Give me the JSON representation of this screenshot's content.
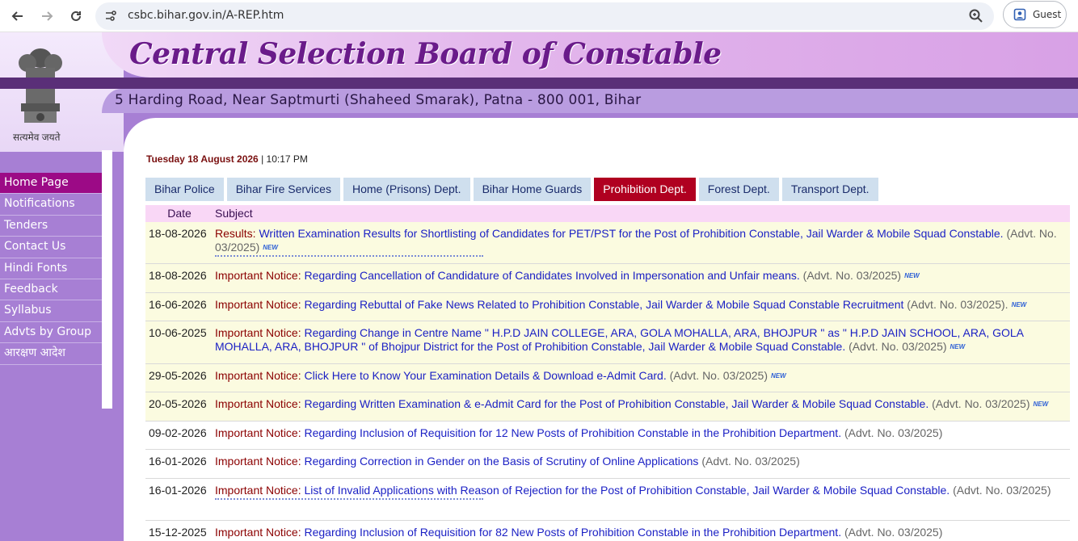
{
  "browser": {
    "url": "csbc.bihar.gov.in/A-REP.htm",
    "profile_label": "Guest"
  },
  "header": {
    "title": "Central Selection Board of Constable",
    "address": "5 Harding Road, Near Saptmurti (Shaheed Smarak), Patna - 800 001, Bihar",
    "motto": "सत्यमेव जयते"
  },
  "sidebar": {
    "items": [
      {
        "label": "Home Page"
      },
      {
        "label": "Notifications"
      },
      {
        "label": "Tenders"
      },
      {
        "label": "Contact Us"
      },
      {
        "label": "Hindi Fonts"
      },
      {
        "label": "Feedback"
      },
      {
        "label": "Syllabus"
      },
      {
        "label": "Advts by Group"
      },
      {
        "label": "आरक्षण आदेश"
      }
    ]
  },
  "datetime": {
    "date": "Tuesday 18 August 2026",
    "sep": "|",
    "time": "10:17 PM"
  },
  "tabs": [
    {
      "label": "Bihar Police"
    },
    {
      "label": "Bihar Fire Services"
    },
    {
      "label": "Home (Prisons) Dept."
    },
    {
      "label": "Bihar Home Guards"
    },
    {
      "label": "Prohibition Dept."
    },
    {
      "label": "Forest Dept."
    },
    {
      "label": "Transport Dept."
    }
  ],
  "table": {
    "headers": {
      "date": "Date",
      "subject": "Subject"
    },
    "rows": [
      {
        "date": "18-08-2026",
        "prefix": "Results:",
        "link": "Written Examination Results for Shortlisting of Candidates for PET/PST for the Post of Prohibition Constable, Jail Warder & Mobile Squad Constable.",
        "advt": "(Advt. No. 03/2025)",
        "new_badge": "NEW"
      },
      {
        "date": "18-08-2026",
        "prefix": "Important Notice:",
        "link": "Regarding Cancellation of Candidature of Candidates Involved in Impersonation and Unfair means.",
        "advt": "(Advt. No. 03/2025)",
        "new_badge": "NEW"
      },
      {
        "date": "16-06-2026",
        "prefix": "Important Notice:",
        "link": "Regarding Rebuttal of Fake News Related to Prohibition Constable, Jail Warder & Mobile Squad Constable Recruitment",
        "advt": "(Advt. No. 03/2025).",
        "new_badge": "NEW"
      },
      {
        "date": "10-06-2025",
        "prefix": "Important Notice:",
        "link": "Regarding Change in Centre Name \" H.P.D JAIN COLLEGE, ARA, GOLA MOHALLA, ARA, BHOJPUR \" as \" H.P.D JAIN SCHOOL, ARA, GOLA MOHALLA, ARA, BHOJPUR \" of Bhojpur District for the Post of Prohibition Constable, Jail Warder & Mobile Squad Constable.",
        "advt": "(Advt. No. 03/2025)",
        "new_badge": "NEW"
      },
      {
        "date": "29-05-2026",
        "prefix": "Important Notice:",
        "link": "Click Here to Know Your Examination Details & Download e-Admit Card.",
        "advt": "(Advt. No. 03/2025)",
        "new_badge": "NEW"
      },
      {
        "date": "20-05-2026",
        "prefix": "Important Notice:",
        "link": "Regarding Written Examination & e-Admit Card for the Post of Prohibition Constable, Jail Warder & Mobile Squad Constable.",
        "advt": "(Advt. No. 03/2025)",
        "new_badge": "NEW"
      },
      {
        "date": "09-02-2026",
        "prefix": "Important Notice:",
        "link": "Regarding Inclusion of Requisition for 12 New Posts of Prohibition Constable in the Prohibition Department.",
        "advt": "(Advt. No. 03/2025)",
        "new_badge": ""
      },
      {
        "date": "16-01-2026",
        "prefix": "Important Notice:",
        "link": "Regarding Correction in Gender on the Basis of Scrutiny of Online Applications",
        "advt": "(Advt. No. 03/2025)",
        "new_badge": ""
      },
      {
        "date": "16-01-2026",
        "prefix": "Important Notice:",
        "link": "List of Invalid Applications with Reason of Rejection for the Post of Prohibition Constable, Jail Warder & Mobile Squad Constable.",
        "advt": "(Advt. No. 03/2025)",
        "new_badge": ""
      },
      {
        "date": "15-12-2025",
        "prefix": "Important Notice:",
        "link": "Regarding Inclusion of Requisition for 82 New Posts of Prohibition Constable in the Prohibition Department.",
        "advt": "(Advt. No. 03/2025)",
        "new_badge": ""
      }
    ]
  }
}
